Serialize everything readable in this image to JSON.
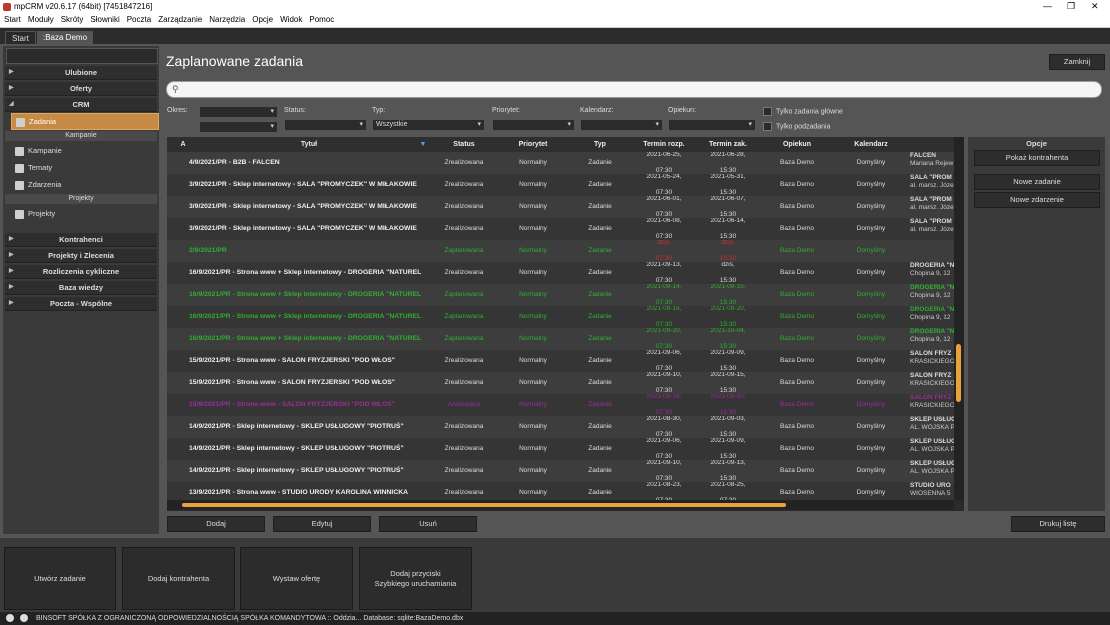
{
  "window": {
    "title": "mpCRM v20.6.17 (64bit) [7451847216]",
    "min": "—",
    "max": "❐",
    "close": "✕"
  },
  "menu": [
    "Start",
    "Moduły",
    "Skróty",
    "Słowniki",
    "Poczta",
    "Zarządzanie",
    "Narzędzia",
    "Opcje",
    "Widok",
    "Pomoc"
  ],
  "tabs": {
    "start": "Start",
    "demo": ":Baza Demo"
  },
  "sidebar": {
    "ulubione": "Ulubione",
    "oferty": "Oferty",
    "crm": "CRM",
    "zadania": "Zadania",
    "kampanie_sub": "Kampanie",
    "kampanie": "Kampanie",
    "tematy": "Tematy",
    "zdarzenia": "Zdarzenia",
    "projekty_sub": "Projekty",
    "projekty": "Projekty",
    "kontrahenci": "Kontrahenci",
    "projekty_zlecenia": "Projekty i Zlecenia",
    "rozliczenia": "Rozliczenia cykliczne",
    "baza_wiedzy": "Baza wiedzy",
    "poczta": "Poczta - Wspólne"
  },
  "page_title": "Zaplanowane zadania",
  "buttons": {
    "zamknij": "Zamknij",
    "dodaj": "Dodaj",
    "edytuj": "Edytuj",
    "usun": "Usuń",
    "drukuj": "Drukuj listę"
  },
  "filters": {
    "okres": "Okres:",
    "status": "Status:",
    "typ": "Typ:",
    "typ_value": "Wszystkie",
    "priorytet": "Priorytet:",
    "kalendarz": "Kalendarz:",
    "opiekun": "Opiekun:",
    "glowne": "Tylko zadania główne",
    "podzadania": "Tylko podzadania"
  },
  "columns": {
    "a": "A",
    "tytul": "Tytuł",
    "status": "Status",
    "priorytet": "Priorytet",
    "typ": "Typ",
    "rozp": "Termin rozp.",
    "zak": "Termin zak.",
    "opiekun": "Opiekun",
    "kalendarz": "Kalendarz"
  },
  "rows": [
    {
      "t": "4/9/2021/PR - B2B - FALCEN",
      "s": "Zrealizowana",
      "p": "Normalny",
      "ty": "Zadanie",
      "r1": "2021-06-25,",
      "r2": "07:30",
      "z1": "2021-06-28,",
      "z2": "15:30",
      "o": "Baza Demo",
      "k": "Domyślny",
      "c1": "FALCEN",
      "c2": "Mariana Rejew",
      "cls": "a"
    },
    {
      "t": "3/9/2021/PR - Sklep internetowy - SALA \"PROMYCZEK\" W MIŁAKOWIE",
      "s": "Zrealizowana",
      "p": "Normalny",
      "ty": "Zadanie",
      "r1": "2021-05-24,",
      "r2": "07:30",
      "z1": "2021-05-31,",
      "z2": "15:30",
      "o": "Baza Demo",
      "k": "Domyślny",
      "c1": "SALA \"PROM",
      "c2": "al. marsz. Józe",
      "cls": "b"
    },
    {
      "t": "3/9/2021/PR - Sklep internetowy - SALA \"PROMYCZEK\" W MIŁAKOWIE",
      "s": "Zrealizowana",
      "p": "Normalny",
      "ty": "Zadanie",
      "r1": "2021-06-01,",
      "r2": "07:30",
      "z1": "2021-06-07,",
      "z2": "15:30",
      "o": "Baza Demo",
      "k": "Domyślny",
      "c1": "SALA \"PROM",
      "c2": "al. marsz. Józe",
      "cls": "a"
    },
    {
      "t": "3/9/2021/PR - Sklep internetowy - SALA \"PROMYCZEK\" W MIŁAKOWIE",
      "s": "Zrealizowana",
      "p": "Normalny",
      "ty": "Zadanie",
      "r1": "2021-06-08,",
      "r2": "07:30",
      "z1": "2021-06-14,",
      "z2": "15:30",
      "o": "Baza Demo",
      "k": "Domyślny",
      "c1": "SALA \"PROM",
      "c2": "al. marsz. Józe",
      "cls": "b"
    },
    {
      "t": "2/9/2021/PR",
      "s": "Zaplanowana",
      "p": "Normalny",
      "ty": "Zadanie",
      "r1": "dziś,",
      "r2": "07:30",
      "z1": "dziś,",
      "z2": "15:30",
      "o": "Baza Demo",
      "k": "Domyślny",
      "c1": "",
      "c2": "",
      "cls": "a green",
      "red": true
    },
    {
      "t": "16/9/2021/PR - Strona www + Sklep internetowy - DROGERIA \"NATUREL",
      "s": "Zrealizowana",
      "p": "Normalny",
      "ty": "Zadanie",
      "r1": "2021-09-13,",
      "r2": "07:30",
      "z1": "dziś,",
      "z2": "15:30",
      "o": "Baza Demo",
      "k": "Domyślny",
      "c1": "DROGERIA \"N",
      "c2": "Chopina 9, 12",
      "cls": "b"
    },
    {
      "t": "16/9/2021/PR - Strona www + Sklep internetowy - DROGERIA \"NATUREL",
      "s": "Zaplanowana",
      "p": "Normalny",
      "ty": "Zadanie",
      "r1": "2021-09-14,",
      "r2": "07:30",
      "z1": "2021-09-15,",
      "z2": "15:30",
      "o": "Baza Demo",
      "k": "Domyślny",
      "c1": "DROGERIA \"N",
      "c2": "Chopina 9, 12",
      "cls": "a green"
    },
    {
      "t": "16/9/2021/PR - Strona www + Sklep internetowy - DROGERIA \"NATUREL",
      "s": "Zaplanowana",
      "p": "Normalny",
      "ty": "Zadanie",
      "r1": "2021-09-16,",
      "r2": "07:30",
      "z1": "2021-09-20,",
      "z2": "15:30",
      "o": "Baza Demo",
      "k": "Domyślny",
      "c1": "DROGERIA \"N",
      "c2": "Chopina 9, 12",
      "cls": "b green"
    },
    {
      "t": "16/9/2021/PR - Strona www + Sklep internetowy - DROGERIA \"NATUREL",
      "s": "Zaplanowana",
      "p": "Normalny",
      "ty": "Zadanie",
      "r1": "2021-09-20,",
      "r2": "07:30",
      "z1": "2021-10-04,",
      "z2": "15:30",
      "o": "Baza Demo",
      "k": "Domyślny",
      "c1": "DROGERIA \"N",
      "c2": "Chopina 9, 12",
      "cls": "a green"
    },
    {
      "t": "15/9/2021/PR - Strona www - SALON FRYZJERSKI \"POD WŁOS\"",
      "s": "Zrealizowana",
      "p": "Normalny",
      "ty": "Zadanie",
      "r1": "2021-09-06,",
      "r2": "07:30",
      "z1": "2021-09-09,",
      "z2": "15:30",
      "o": "Baza Demo",
      "k": "Domyślny",
      "c1": "SALON FRYZ",
      "c2": "KRASICKIEGO",
      "cls": "b"
    },
    {
      "t": "15/9/2021/PR - Strona www - SALON FRYZJERSKI \"POD WŁOS\"",
      "s": "Zrealizowana",
      "p": "Normalny",
      "ty": "Zadanie",
      "r1": "2021-09-10,",
      "r2": "07:30",
      "z1": "2021-09-15,",
      "z2": "15:30",
      "o": "Baza Demo",
      "k": "Domyślny",
      "c1": "SALON FRYZ",
      "c2": "KRASICKIEGO",
      "cls": "a"
    },
    {
      "t": "15/9/2021/PR - Strona www - SALON FRYZJERSKI \"POD WŁOS\"",
      "s": "Anulowana",
      "p": "Normalny",
      "ty": "Zadanie",
      "r1": "2021-09-16,",
      "r2": "07:30",
      "z1": "2021-09-20,",
      "z2": "15:30",
      "o": "Baza Demo",
      "k": "Domyślny",
      "c1": "SALON FRYZ",
      "c2": "KRASICKIEGO",
      "cls": "b purple"
    },
    {
      "t": "14/9/2021/PR - Sklep internetowy - SKLEP USŁUGOWY \"PIOTRUŚ\"",
      "s": "Zrealizowana",
      "p": "Normalny",
      "ty": "Zadanie",
      "r1": "2021-08-30,",
      "r2": "07:30",
      "z1": "2021-09-03,",
      "z2": "15:30",
      "o": "Baza Demo",
      "k": "Domyślny",
      "c1": "SKLEP USŁUG",
      "c2": "AL. WOJSKA P",
      "cls": "a"
    },
    {
      "t": "14/9/2021/PR - Sklep internetowy - SKLEP USŁUGOWY \"PIOTRUŚ\"",
      "s": "Zrealizowana",
      "p": "Normalny",
      "ty": "Zadanie",
      "r1": "2021-09-06,",
      "r2": "07:30",
      "z1": "2021-09-09,",
      "z2": "15:30",
      "o": "Baza Demo",
      "k": "Domyślny",
      "c1": "SKLEP USŁUG",
      "c2": "AL. WOJSKA P",
      "cls": "b"
    },
    {
      "t": "14/9/2021/PR - Sklep internetowy - SKLEP USŁUGOWY \"PIOTRUŚ\"",
      "s": "Zrealizowana",
      "p": "Normalny",
      "ty": "Zadanie",
      "r1": "2021-09-10,",
      "r2": "07:30",
      "z1": "2021-09-13,",
      "z2": "15:30",
      "o": "Baza Demo",
      "k": "Domyślny",
      "c1": "SKLEP USŁUG",
      "c2": "AL. WOJSKA P",
      "cls": "a"
    },
    {
      "t": "13/9/2021/PR - Strona www - STUDIO URODY KAROLINA WINNICKA",
      "s": "Zrealizowana",
      "p": "Normalny",
      "ty": "Zadanie",
      "r1": "2021-08-23,",
      "r2": "07:30",
      "z1": "2021-08-25,",
      "z2": "07:30",
      "o": "Baza Demo",
      "k": "Domyślny",
      "c1": "STUDIO URO",
      "c2": "WIOSENNA 5",
      "cls": "b"
    }
  ],
  "options": {
    "title": "Opcje",
    "pokaz": "Pokaż kontrahenta",
    "nowe_zadanie": "Nowe zadanie",
    "nowe_zdarzenie": "Nowe zdarzenie"
  },
  "bottom": {
    "b1": "Utwórz zadanie",
    "b2": "Dodaj kontrahenta",
    "b3": "Wystaw ofertę",
    "b4a": "Dodaj przyciski",
    "b4b": "Szybkiego uruchamiania"
  },
  "status": "BINSOFT SPÓŁKA Z OGRANICZONĄ ODPOWIEDZIALNOŚCIĄ SPÓŁKA KOMANDYTOWA :: Oddzia... Database: sqlite:BazaDemo.dbx"
}
